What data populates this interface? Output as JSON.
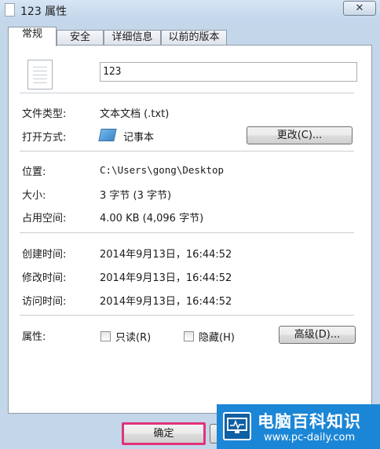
{
  "window": {
    "title": "123 属性",
    "close_glyph": "✕"
  },
  "tabs": [
    {
      "label": "常规",
      "active": true
    },
    {
      "label": "安全"
    },
    {
      "label": "详细信息"
    },
    {
      "label": "以前的版本"
    }
  ],
  "general": {
    "file_name": "123",
    "file_type": {
      "label": "文件类型:",
      "value": "文本文档 (.txt)"
    },
    "opens_with": {
      "label": "打开方式:",
      "value": "记事本",
      "change_button": "更改(C)..."
    },
    "location": {
      "label": "位置:",
      "value": "C:\\Users\\gong\\Desktop"
    },
    "size": {
      "label": "大小:",
      "value": "3 字节 (3 字节)"
    },
    "size_on_disk": {
      "label": "占用空间:",
      "value": "4.00 KB (4,096 字节)"
    },
    "created": {
      "label": "创建时间:",
      "value": "2014年9月13日，16:44:52"
    },
    "modified": {
      "label": "修改时间:",
      "value": "2014年9月13日，16:44:52"
    },
    "accessed": {
      "label": "访问时间:",
      "value": "2014年9月13日，16:44:52"
    },
    "attributes": {
      "label": "属性:",
      "readonly": {
        "label": "只读(R)",
        "checked": false
      },
      "hidden": {
        "label": "隐藏(H)",
        "checked": false
      },
      "advanced_button": "高级(D)..."
    }
  },
  "footer": {
    "ok_button": "确定",
    "highlight_color": "#e0337a"
  },
  "watermark": {
    "title": "电脑百科知识",
    "url": "www.pc-daily.com",
    "color": "#1c86d6"
  },
  "icons": [
    "text-file-icon",
    "notepad-icon",
    "close-icon",
    "monitor-logo-icon"
  ]
}
